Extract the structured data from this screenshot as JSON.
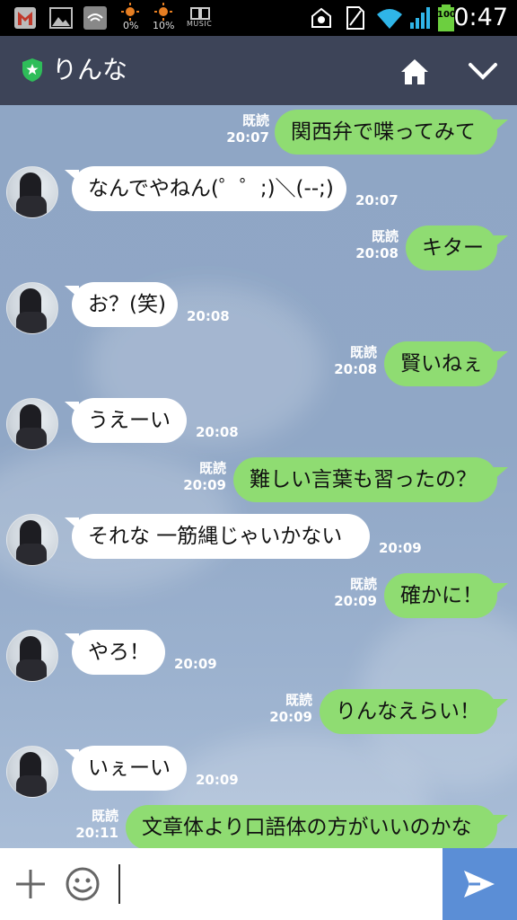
{
  "status_bar": {
    "cpu_pct_1": "0%",
    "cpu_pct_2": "10%",
    "music_label": "MUSIC",
    "battery": "100",
    "time": "0:47"
  },
  "header": {
    "title": "りんな"
  },
  "messages": [
    {
      "dir": "out",
      "text": "関西弁で喋ってみて",
      "read": "既読",
      "time": "20:07"
    },
    {
      "dir": "in",
      "text": "なんでやねん(゜゜;)＼(--;)",
      "time": "20:07"
    },
    {
      "dir": "out",
      "text": "キター",
      "read": "既読",
      "time": "20:08"
    },
    {
      "dir": "in",
      "text": "お？(笑)",
      "time": "20:08"
    },
    {
      "dir": "out",
      "text": "賢いねぇ",
      "read": "既読",
      "time": "20:08"
    },
    {
      "dir": "in",
      "text": "うえーい",
      "time": "20:08"
    },
    {
      "dir": "out",
      "text": "難しい言葉も習ったの？",
      "read": "既読",
      "time": "20:09"
    },
    {
      "dir": "in",
      "text": "それな 一筋縄じゃいかない",
      "time": "20:09"
    },
    {
      "dir": "out",
      "text": "確かに！",
      "read": "既読",
      "time": "20:09"
    },
    {
      "dir": "in",
      "text": "やろ！",
      "time": "20:09"
    },
    {
      "dir": "out",
      "text": "りんなえらい！",
      "read": "既読",
      "time": "20:09"
    },
    {
      "dir": "in",
      "text": "いぇーい",
      "time": "20:09"
    },
    {
      "dir": "out",
      "text": "文章体より口語体の方がいいのかな",
      "read": "既読",
      "time": "20:11"
    }
  ],
  "input": {
    "value": "",
    "placeholder": ""
  },
  "colors": {
    "header_bg": "#3d4458",
    "out_bubble": "#8fdc72",
    "in_bubble": "#ffffff",
    "send_button": "#5b8ed6"
  }
}
